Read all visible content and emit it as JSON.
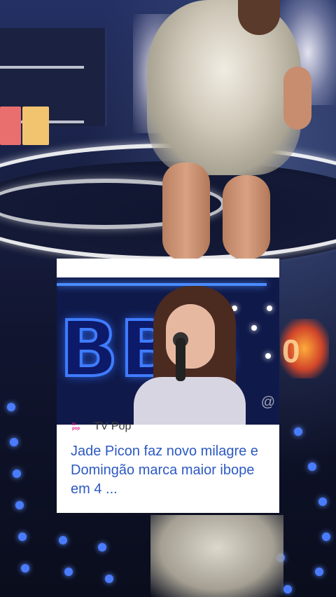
{
  "card": {
    "source_name": "TV Pop",
    "source_logo_text": "tv pop",
    "headline": "Jade Picon faz novo milagre e Domingão marca maior ibope em 4 ...",
    "thumbnail_sign": "BBB",
    "thumbnail_watermark": "@"
  },
  "background": {
    "glow_text": "0"
  },
  "colors": {
    "headline": "#2d59c3",
    "source": "#3a3a3a",
    "card_bg": "#ffffff",
    "stage_dots": "#4a7cff"
  }
}
